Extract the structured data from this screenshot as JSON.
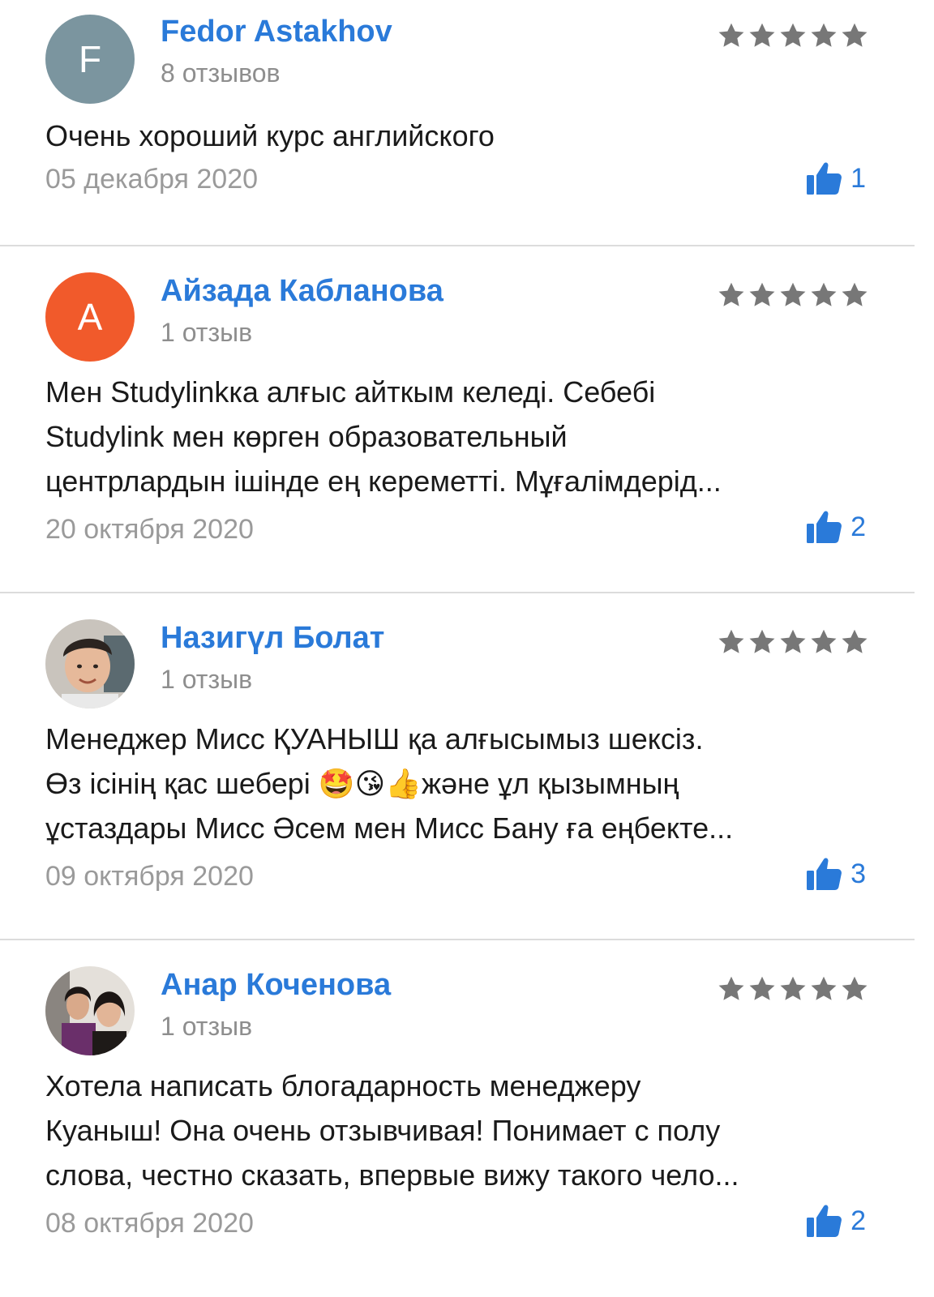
{
  "reviews": [
    {
      "author": "Fedor Astakhov",
      "review_count": "8 отзывов",
      "avatar": {
        "type": "initial",
        "initial": "F",
        "color": "#7b959f"
      },
      "rating": 5,
      "text_lines": [
        "Очень хороший курс английского"
      ],
      "date": "05 декабря 2020",
      "likes": "1"
    },
    {
      "author": "Айзада Кабланова",
      "review_count": "1 отзыв",
      "avatar": {
        "type": "initial",
        "initial": "А",
        "color": "#f15a2b"
      },
      "rating": 5,
      "text_lines": [
        "Мен Studylinkка алғыс айткым келеді. Себебі",
        "Studylink мен көрген образовательный",
        "центрлардын ішінде ең кереметті. Мұғалімдерід..."
      ],
      "date": "20 октября 2020",
      "likes": "2"
    },
    {
      "author": "Назигүл Болат",
      "review_count": "1 отзыв",
      "avatar": {
        "type": "photo",
        "icon": "user-photo"
      },
      "rating": 5,
      "text_lines": [
        "Менеджер Мисс ҚУАНЫШ қа алғысымыз шексіз.",
        "Өз ісінің қас шебері 🤩😘👍және ұл қызымның",
        "ұстаздары Мисс Әсем мен Мисс Бану ға еңбекте..."
      ],
      "date": "09 октября 2020",
      "likes": "3"
    },
    {
      "author": "Анар Коченова",
      "review_count": "1 отзыв",
      "avatar": {
        "type": "photo",
        "icon": "user-photo"
      },
      "rating": 5,
      "text_lines": [
        "Хотела написать блогадарность менеджеру",
        "Куаныш! Она очень отзывчивая! Понимает с полу",
        "слова, честно сказать, впервые вижу такого чело..."
      ],
      "date": "08 октября 2020",
      "likes": "2"
    }
  ],
  "colors": {
    "link": "#2a7ad9",
    "star": "#7a7a7a",
    "muted": "#9a9a9a",
    "divider": "#dcdcdc"
  },
  "icons": {
    "star": "star-icon",
    "like": "thumbs-up-icon"
  }
}
